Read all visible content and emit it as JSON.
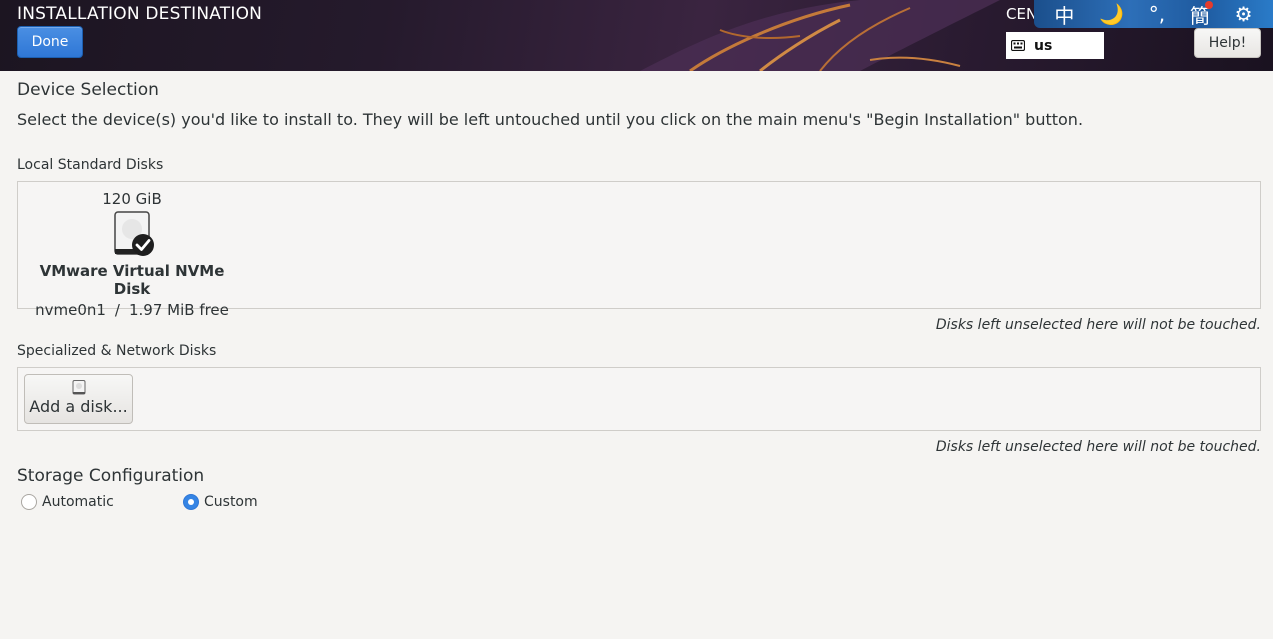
{
  "header": {
    "title": "INSTALLATION DESTINATION",
    "done_label": "Done",
    "distro_label": "CEN",
    "keyboard_layout": "us",
    "help_label": "Help!",
    "ime_chars": [
      "中",
      "🌙",
      "°,",
      "簡",
      "⚙"
    ]
  },
  "device_selection": {
    "title": "Device Selection",
    "description": "Select the device(s) you'd like to install to.  They will be left untouched until you click on the main menu's \"Begin Installation\" button."
  },
  "local_disks": {
    "title": "Local Standard Disks",
    "disks": [
      {
        "size": "120 GiB",
        "name": "VMware Virtual NVMe Disk",
        "device": "nvme0n1",
        "separator": "/",
        "free": "1.97 MiB free",
        "selected": true
      }
    ],
    "note": "Disks left unselected here will not be touched."
  },
  "network_disks": {
    "title": "Specialized & Network Disks",
    "add_label": "Add a disk...",
    "note": "Disks left unselected here will not be touched."
  },
  "storage": {
    "title": "Storage Configuration",
    "options": [
      {
        "label": "Automatic",
        "checked": false
      },
      {
        "label": "Custom",
        "checked": true
      }
    ]
  },
  "colors": {
    "accent": "#3584e4",
    "header_bg": "#251a2c"
  }
}
